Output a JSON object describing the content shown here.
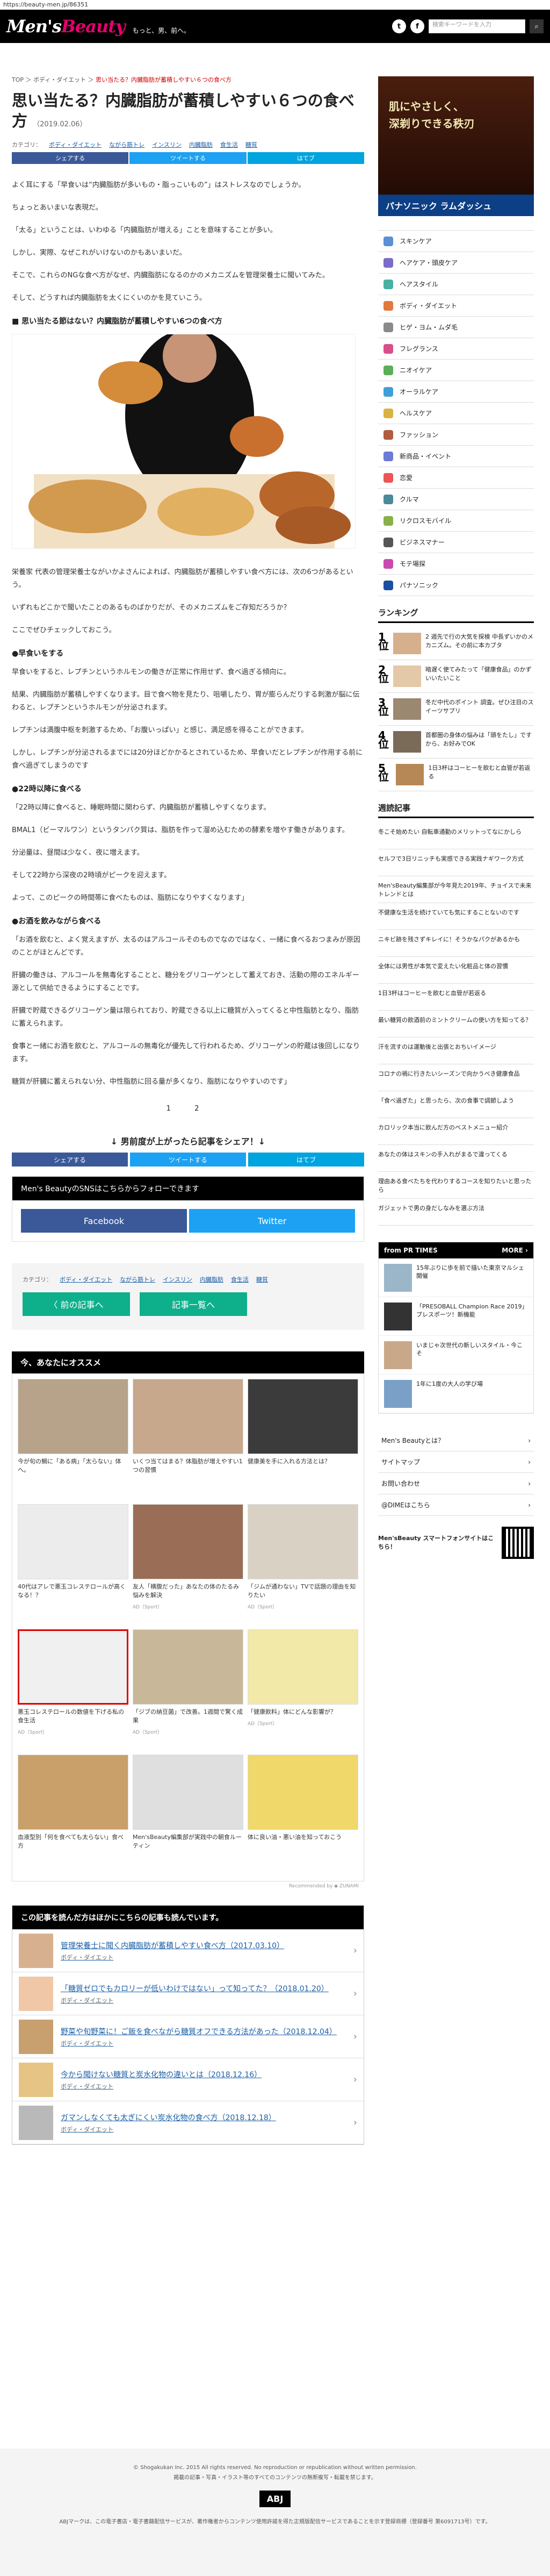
{
  "url": "https://beauty-men.jp/86351",
  "header": {
    "logo_a": "Men's",
    "logo_b": "Beauty",
    "tagline": "もっと、男、前へ。",
    "search_placeholder": "検索キーワードを入力"
  },
  "breadcrumb": [
    "TOP",
    "ボディ・ダイエット",
    "思い当たる？内臓脂肪が蓄積しやすい６つの食べ方"
  ],
  "article": {
    "title": "思い当たる？内臓脂肪が蓄積しやすい６つの食べ方",
    "date": "（2019.02.06）",
    "cats_label": "カテゴリ：",
    "cats": [
      "ボディ・ダイエット",
      "ながら筋トレ",
      "インスリン",
      "内臓脂肪",
      "食生活",
      "糖質"
    ],
    "share": [
      "シェアする",
      "ツイートする",
      "はてブ"
    ],
    "intro": [
      "よく耳にする「早食いは“内臓脂肪が多いもの・脂っこいもの”」はストレスなのでしょうか。",
      "ちょっとあいまいな表現だ。",
      "「太る」ということは、いわゆる「内臓脂肪が増える」ことを意味することが多い。",
      "しかし、実際、なぜこれがいけないのかもあいまいだ。",
      "そこで、これらのNGな食べ方がなぜ、内臓脂肪になるのかのメカニズムを管理栄養士に聞いてみた。",
      "そして、どうすれば内臓脂肪を太くにくいのかを見ていこう。"
    ],
    "section1": "■ 思い当たる節はない？内臓脂肪が蓄積しやすい6つの食べ方",
    "body": [
      "栄養家 代表の管理栄養士ながいかよさんによれば、内臓脂肪が蓄積しやすい食べ方には、次の6つがあるという。",
      "いずれもどこかで聞いたことのあるものばかりだが、そのメカニズムをご存知だろうか？",
      "ここでぜひチェックしておこう。"
    ],
    "h_fast": "●早食いをする",
    "fast": [
      "早食いをすると、レプチンというホルモンの働きが正常に作用せず、食べ過ぎる傾向に。",
      "結果、内臓脂肪が蓄積しやすくなります。目で食べ物を見たり、咀嚼したり、胃が膨らんだりする刺激が脳に伝わると、レプチンというホルモンが分泌されます。",
      "レプチンは満腹中枢を刺激するため、「お腹いっぱい」と感じ、満足感を得ることができます。",
      "しかし、レプチンが分泌されるまでには20分ほどかかるとされているため、早食いだとレプチンが作用する前に食べ過ぎてしまうのです"
    ],
    "h_late": "●22時以降に食べる",
    "late": [
      "「22時以降に食べると、睡眠時間に関わらず、内臓脂肪が蓄積しやすくなります。",
      "BMAL1（ビーマルワン）というタンパク質は、脂肪を作って溜め込むための酵素を増やす働きがあります。",
      "分泌量は、昼間は少なく、夜に増えます。",
      "そして22時から深夜の2時頃がピークを迎えます。",
      "よって、このピークの時間帯に食べたものは、脂肪になりやすくなります」"
    ],
    "h_alc": "●お酒を飲みながら食べる",
    "alc": [
      "「お酒を飲むと、よく覚えますが、太るのはアルコールそのものでなのではなく、一緒に食べるおつまみが原因のことがほとんどです。",
      "肝臓の働きは、アルコールを無毒化することと、糖分をグリコーゲンとして蓄えておき、活動の際のエネルギー源として供給できるようにすることです。",
      "肝臓で貯蔵できるグリコーゲン量は限られており、貯蔵できる以上に糖質が入ってくると中性脂肪となり、脂肪に蓄えられます。",
      "食事と一緒にお酒を飲むと、アルコールの無毒化が優先して行われるため、グリコーゲンの貯蔵は後回しになります。",
      "糖質が肝臓に蓄えられない分、中性脂肪に回る量が多くなり、脂肪になりやすいのです」"
    ],
    "pages": [
      "1",
      "2"
    ]
  },
  "like_title": "↓ 男前度が上がったら記事をシェア！↓",
  "share2": [
    "シェアする",
    "ツイートする",
    "はてブ"
  ],
  "sns": {
    "title": "Men's BeautyのSNSはこちらからフォローできます",
    "fb": "Facebook",
    "tw": "Twitter"
  },
  "nav": {
    "prev": "〈 前の記事へ",
    "list": "記事一覧へ"
  },
  "rec": {
    "title": "今、あなたにオススメ",
    "items": [
      {
        "t": "今が旬の鯛に「ある病」「太らない」体へ。",
        "s": ""
      },
      {
        "t": "いくつ当てはまる？体脂肪が増えやすい1つの習慣",
        "s": ""
      },
      {
        "t": "健康美を手に入れる方法とは？",
        "s": ""
      },
      {
        "t": "40代はアレで悪玉コレステロールが高くなる！？",
        "s": ""
      },
      {
        "t": "友人「横腹だった」あなたの体のたるみ悩みを解決",
        "s": "AD（Sport）"
      },
      {
        "t": "「ジムが通わない」TVで話題の理由を知りたい",
        "s": "AD（Sport）"
      },
      {
        "t": "悪玉コレステロールの数値を下げる私の食生活",
        "s": "AD（Sport）"
      },
      {
        "t": "「ジブの納豆菌」で改善。1週間で驚く成果",
        "s": "AD（Sport）"
      },
      {
        "t": "「健康飲料」体にどんな影響が？",
        "s": "AD（Sport）"
      },
      {
        "t": "血液型別「何を食べても太らない」食べ方",
        "s": ""
      },
      {
        "t": "Men'sBeauty編集部が実践中の朝食ルーティン",
        "s": ""
      },
      {
        "t": "体に良い油・悪い油を知っておこう",
        "s": ""
      }
    ],
    "foot": "Recommended by ◆ ZUNAMI"
  },
  "related": {
    "title": "この記事を読んだ方はほかにこちらの記事も読んでいます。",
    "items": [
      {
        "t": "管理栄養士に聞く内臓脂肪が蓄積しやすい食べ方（2017.03.10）",
        "c": "ボディ・ダイエット"
      },
      {
        "t": "「糖質ゼロでもカロリーが低いわけではない」って知ってた？（2018.01.20）",
        "c": "ボディ・ダイエット"
      },
      {
        "t": "野菜や旬野菜に！ご飯を食べながら糖質オフできる方法があった（2018.12.04）",
        "c": "ボディ・ダイエット"
      },
      {
        "t": "今から聞けない糖質と炭水化物の違いとは（2018.12.16）",
        "c": "ボディ・ダイエット"
      },
      {
        "t": "ガマンしなくても太ぎにくい炭水化物の食べ方（2018.12.18）",
        "c": "ボディ・ダイエット"
      }
    ]
  },
  "side": {
    "ad": {
      "h1": "肌にやさしく、",
      "h2": "深剃りできる秩刃",
      "bar": "パナソニック ラムダッシュ"
    },
    "cats": [
      "スキンケア",
      "ヘアケア・頭皮ケア",
      "ヘアスタイル",
      "ボディ・ダイエット",
      "ヒゲ・ヨム・ムダ毛",
      "フレグランス",
      "ニオイケア",
      "オーラルケア",
      "ヘルスケア",
      "ファッション",
      "新商品・イベント",
      "恋愛",
      "クルマ",
      "リクロスモバイル",
      "ビジネスマナー",
      "モテ場探",
      "パナソニック"
    ],
    "ranking_title": "ランキング",
    "ranking": [
      {
        "r": "1位",
        "t": "2 週先で行の大気を探検 中長ずいかのメカニズム。その前に本カブタ"
      },
      {
        "r": "2位",
        "t": "暗遅く使てみたって「健康食品」のかずいいたいこと"
      },
      {
        "r": "3位",
        "t": "冬だ中代のポイント 調査。ぜひ注目のスイーツサプリ"
      },
      {
        "r": "4位",
        "t": "首都圏の身体の悩みは「頭をたし」ですから、お好みでOK"
      },
      {
        "r": "5位",
        "t": "1日3杯はコーヒーを飲むと血管が若返る"
      }
    ],
    "new_title": "週読記事",
    "new": [
      "冬こそ始めたい 自転車通勤のメリットってなにかしら",
      "セルフで3日リニッチも実感できる実践ナギワーク方式",
      "Men'sBeauty編集部が今年見た2019年、チョイスで未来トレンドとは",
      "不健康な生活を続けていても気にすることないのです",
      "ニキビ跡を残さずキレイに！そうかなパクがあるかも",
      "全体には男性が本気で変えたい化粧品と体の習慣",
      "1日3杯はコーヒーを飲むと血管が若返る",
      "最い糖質の飲酒前のミントクリームの使い方を知ってる？",
      "汗を流すのは運動後と出張とおちいイメージ",
      "コロナの禍に行きたいシーズンで向かうべき健康食品",
      "「食べ過ぎた」と思ったら、次の食事で調節しよう",
      "カロリック本当に飲んだ方のベストメニュー紹介",
      "あなたの体はスキンの手入れがまるで違ってくる",
      "理由ある食べたちを代わりするコースを知りたいと思ったら",
      "ガジェットで男の身だしなみを選ぶ方法"
    ],
    "pr_title": "from PR TIMES",
    "pr_more": "MORE ›",
    "pr": [
      "15年ぶりに歩を前で描いた東京マルシェ開催",
      "「PRESOBALL Champion Race 2019」プレスポーツ！新機能",
      "いまじゃ次世代の新しいスタイル・今こそ",
      "1年に1度の大人の学び場"
    ],
    "links": [
      "Men's Beautyとは？",
      "サイトマップ",
      "お問い合わせ",
      "@DIMEはこちら"
    ],
    "app": "Men'sBeauty スマートフォンサイトはこちら！"
  },
  "footer": {
    "copy": "© Shogakukan Inc. 2015  All rights reserved. No reproduction or republication without written permission.",
    "note": "掲載の記事・写真・イラスト等のすべてのコンテンツの無断複写・転載を禁じます。",
    "abj": "ABJ",
    "bottom": "ABJマークは、この電子書店・電子書籍配信サービスが、著作権者からコンテンツ使用許諾を得た正規版配信サービスであることを示す登録商標（登録番号 第6091713号）です。"
  }
}
